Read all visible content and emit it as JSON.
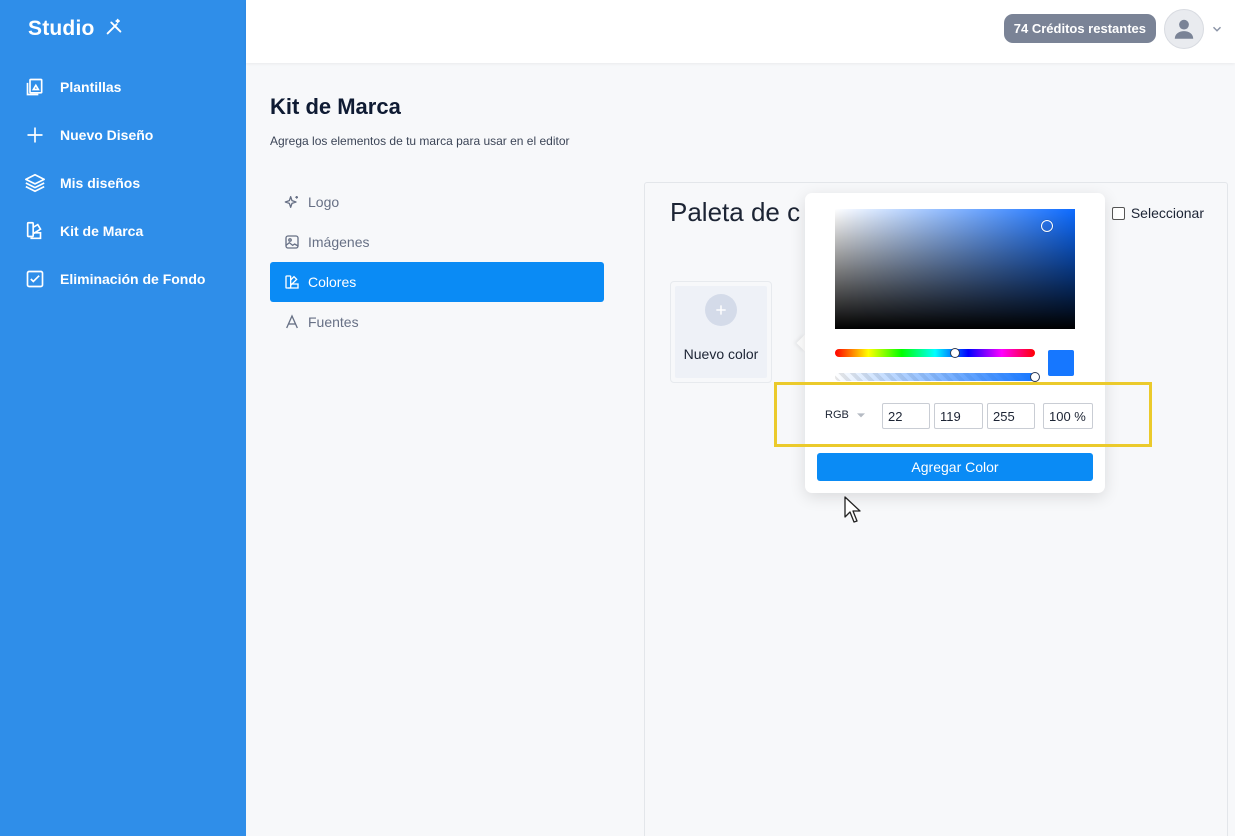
{
  "brand": {
    "name": "Studio"
  },
  "sidebar": {
    "items": [
      {
        "label": "Plantillas",
        "icon": "templates-icon"
      },
      {
        "label": "Nuevo Diseño",
        "icon": "plus-icon"
      },
      {
        "label": "Mis diseños",
        "icon": "layers-icon"
      },
      {
        "label": "Kit de Marca",
        "icon": "brand-kit-icon"
      },
      {
        "label": "Eliminación de Fondo",
        "icon": "checkbox-icon"
      }
    ]
  },
  "topbar": {
    "credits": "74 Créditos restantes"
  },
  "page": {
    "title": "Kit de Marca",
    "subtitle": "Agrega los elementos de tu marca para usar en el editor"
  },
  "menu": {
    "items": [
      {
        "label": "Logo",
        "icon": "sparkle-icon",
        "active": false
      },
      {
        "label": "Imágenes",
        "icon": "image-icon",
        "active": false
      },
      {
        "label": "Colores",
        "icon": "palette-icon",
        "active": true
      },
      {
        "label": "Fuentes",
        "icon": "font-icon",
        "active": false
      }
    ]
  },
  "panel": {
    "title": "Paleta de c",
    "select_label": "Seleccionar",
    "new_color_label": "Nuevo color"
  },
  "picker": {
    "mode": "RGB",
    "r": "22",
    "g": "119",
    "b": "255",
    "alpha": "100 %",
    "add_button": "Agregar Color",
    "color": "#1677ff",
    "hue_level": 0.6,
    "alpha_level": 1.0
  },
  "colors": {
    "sidebar": "#2f8ee9",
    "accent": "#0a8bf5",
    "highlight": "#ebca2b",
    "credits_badge": "#7a8396"
  }
}
